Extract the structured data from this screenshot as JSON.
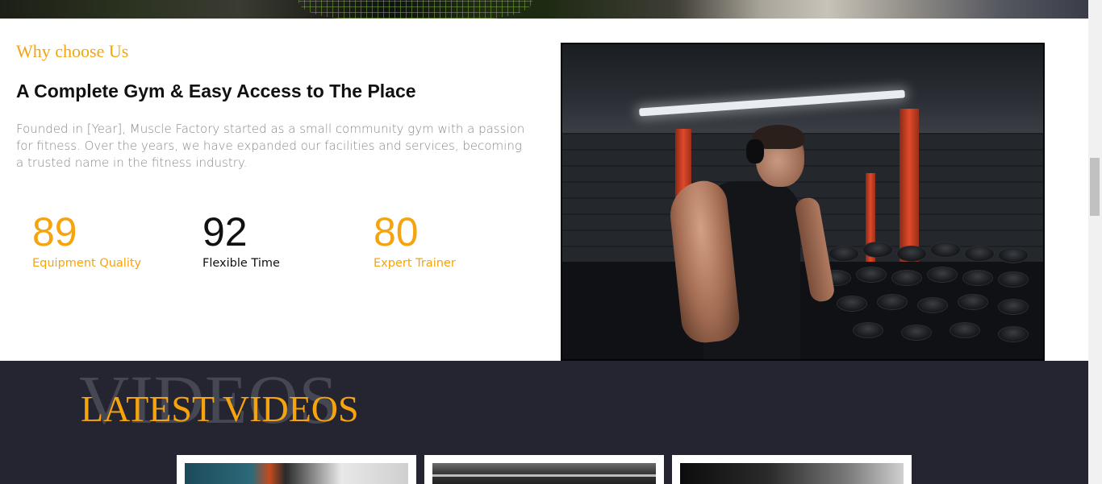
{
  "about": {
    "kicker": "Why choose Us",
    "heading": "A Complete Gym & Easy Access to The Place",
    "paragraph": "Founded in [Year], Muscle Factory started as a small community gym with a passion for fitness. Over the years, we have expanded our facilities and services, becoming a trusted name in the fitness industry.",
    "stats": [
      {
        "value": "89",
        "label": "Equipment Quality"
      },
      {
        "value": "92",
        "label": "Flexible Time"
      },
      {
        "value": "80",
        "label": "Expert Trainer"
      }
    ]
  },
  "videos": {
    "background_word": "VIDEOS",
    "title": "LATEST VIDEOS"
  },
  "colors": {
    "accent": "#f5a410",
    "dark_section": "#252532",
    "heading": "#111111",
    "body_text": "#8a8a8a"
  }
}
